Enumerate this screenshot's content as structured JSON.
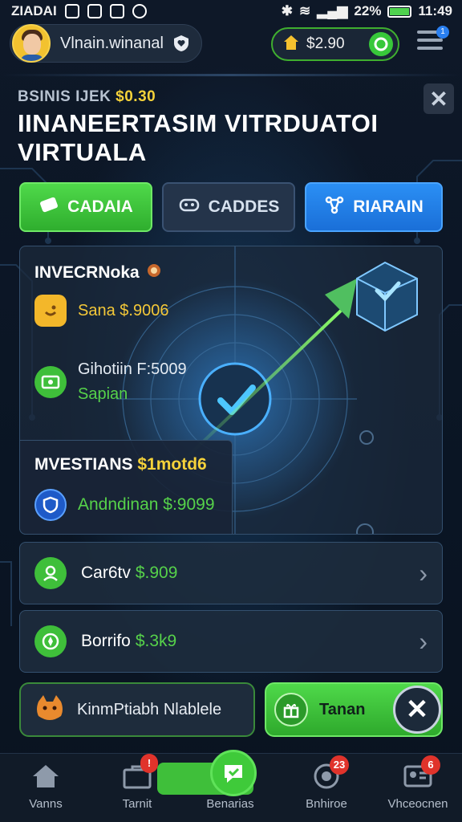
{
  "status_bar": {
    "left_text": "ZIADAI",
    "battery": "22%",
    "time": "11:49"
  },
  "header": {
    "user_name": "Vlnain.winanal",
    "wallet_amount": "$2.90",
    "menu_badge": "1"
  },
  "title_area": {
    "subtitle_prefix": "BSINIS IJEK",
    "subtitle_value": "$0.30",
    "title": "IINANEERTASIM VITRDUATOI VIRTUALA"
  },
  "tabs": [
    {
      "label": "CADAIA",
      "icon": "ticket-icon"
    },
    {
      "label": "CADDES",
      "icon": "gamepad-icon"
    },
    {
      "label": "RIARAIN",
      "icon": "network-icon"
    }
  ],
  "main_card": {
    "heading": "INVECRNoka",
    "row_1": "Sana $.9006",
    "row_2_line_1": "Gihotiin F:5009",
    "row_2_line_2": "Sapian"
  },
  "sub_card": {
    "heading_prefix": "MVESTIANS",
    "heading_value": "$1motd6",
    "row": "Andndinan $:9099"
  },
  "list_rows": [
    {
      "label": "Car6tv",
      "value": "$.909",
      "icon": "user-icon"
    },
    {
      "label": "Borrifo",
      "value": "$.3k9",
      "icon": "compass-icon"
    }
  ],
  "actions": {
    "promo_text": "KinmPtiabh Nlablele",
    "cta_text": "Tanan"
  },
  "bottom_nav": [
    {
      "label": "Vanns",
      "icon": "home-icon",
      "badge": ""
    },
    {
      "label": "Tarnit",
      "icon": "briefcase-icon",
      "badge": ""
    },
    {
      "label": "Benarias",
      "icon": "chat-icon",
      "badge": ""
    },
    {
      "label": "Bnhiroe",
      "icon": "target-icon",
      "badge": "23"
    },
    {
      "label": "Vhceocnen",
      "icon": "id-card-icon",
      "badge": "6"
    }
  ],
  "colors": {
    "accent_green": "#3fbf3a",
    "accent_blue": "#2b8ff4",
    "highlight_yellow": "#f5d23a",
    "background": "#0b1422"
  }
}
